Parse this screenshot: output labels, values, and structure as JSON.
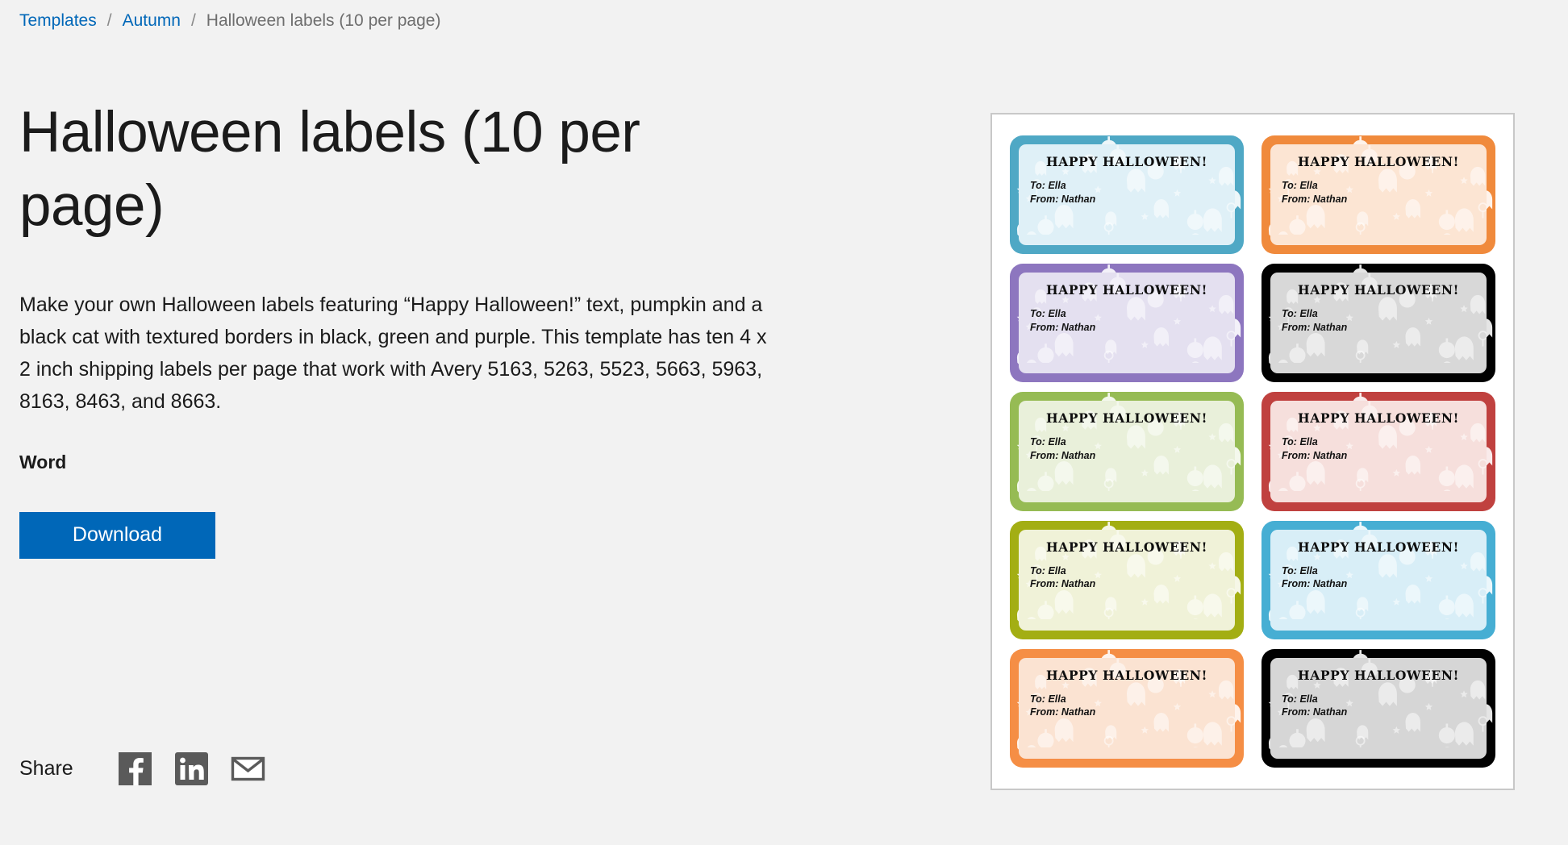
{
  "breadcrumb": {
    "items": [
      {
        "label": "Templates",
        "type": "link"
      },
      {
        "label": "Autumn",
        "type": "link"
      },
      {
        "label": "Halloween labels (10 per page)",
        "type": "current"
      }
    ],
    "separator": "/"
  },
  "main": {
    "title": "Halloween labels (10 per page)",
    "description": "Make your own Halloween labels featuring “Happy Halloween!” text, pumpkin and a black cat with textured borders in black, green and purple. This template has ten 4 x 2 inch shipping labels per page that work with Avery 5163, 5263, 5523, 5663, 5963, 8163, 8463, and 8663.",
    "format_label": "Word",
    "download_label": "Download",
    "download_color": "#0067b8"
  },
  "share": {
    "label": "Share",
    "items": [
      {
        "name": "facebook",
        "title": "Facebook"
      },
      {
        "name": "linkedin",
        "title": "LinkedIn"
      },
      {
        "name": "email",
        "title": "Email"
      }
    ]
  },
  "preview": {
    "heading_text": "HAPPY HALLOWEEN!",
    "to_line": "To: Ella",
    "from_line": "From: Nathan",
    "labels": [
      {
        "color": "#4fa8c5",
        "inner": "#dff0f7"
      },
      {
        "color": "#f08a3c",
        "inner": "#fce5d3"
      },
      {
        "color": "#8d76bf",
        "inner": "#e4e0f0"
      },
      {
        "color": "#010101",
        "inner": "#d8d8d8"
      },
      {
        "color": "#96bb54",
        "inner": "#e9f0da"
      },
      {
        "color": "#c0413f",
        "inner": "#f6dfdc"
      },
      {
        "color": "#a3ae13",
        "inner": "#f0f2d8"
      },
      {
        "color": "#46aed3",
        "inner": "#d8eef7"
      },
      {
        "color": "#f58e45",
        "inner": "#fbe3d2"
      },
      {
        "color": "#010101",
        "inner": "#d6d6d6"
      }
    ]
  }
}
